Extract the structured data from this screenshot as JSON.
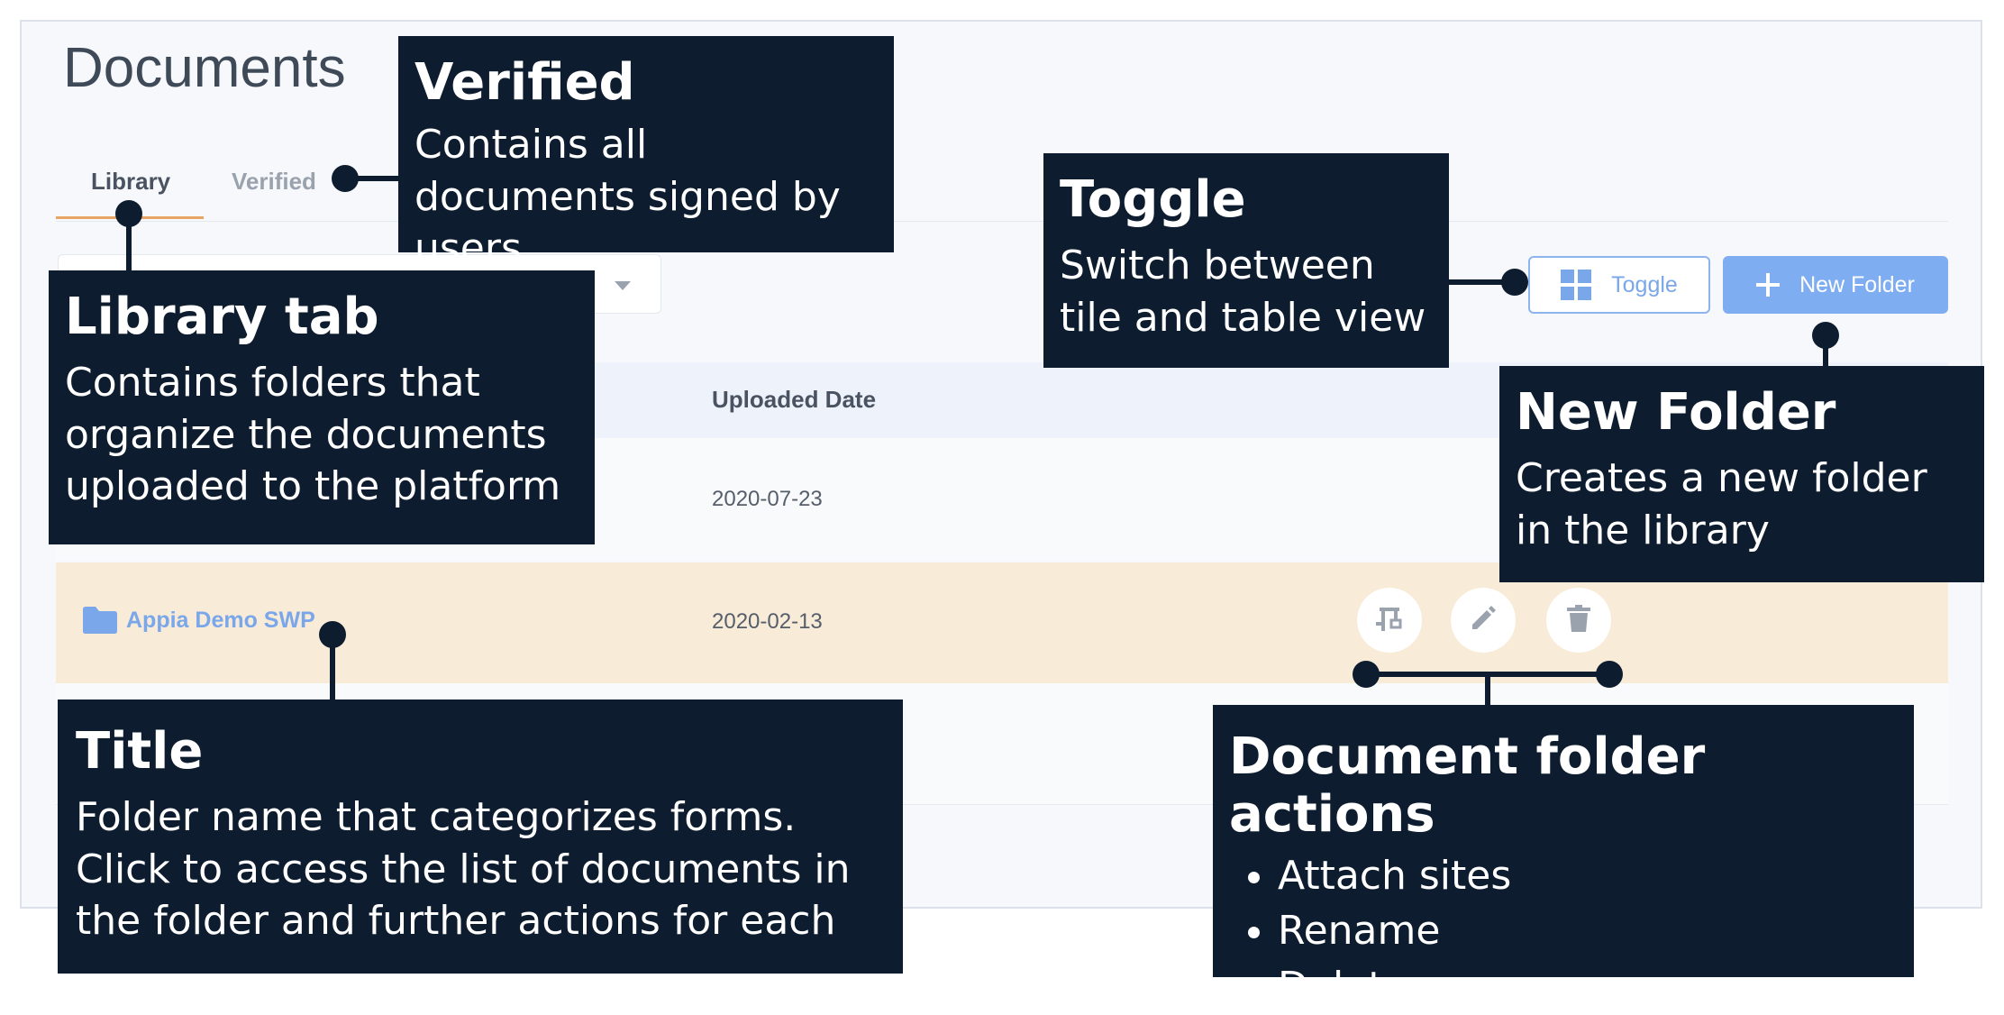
{
  "page": {
    "title": "Documents"
  },
  "tabs": [
    {
      "label": "Library",
      "active": true
    },
    {
      "label": "Verified",
      "active": false
    }
  ],
  "toolbar": {
    "toggle_label": "Toggle",
    "new_folder_label": "New Folder"
  },
  "table": {
    "columns": [
      "Uploaded Date"
    ],
    "rows": [
      {
        "name": "",
        "date": "2020-07-23"
      },
      {
        "name": "Appia Demo SWP",
        "date": "2020-02-13"
      }
    ]
  },
  "callouts": {
    "verified": {
      "title": "Verified",
      "desc": "Contains all documents signed by users"
    },
    "library": {
      "title": "Library tab",
      "desc": "Contains folders that organize the documents uploaded to the platform"
    },
    "toggle": {
      "title": "Toggle",
      "desc": "Switch between tile and table view"
    },
    "new_folder": {
      "title": "New Folder",
      "desc": "Creates a new folder in the library"
    },
    "title": {
      "title": "Title",
      "desc": "Folder name that categorizes forms. Click to access the list of documents in the folder and further actions for each"
    },
    "actions": {
      "title": "Document folder actions",
      "items": [
        "Attach sites",
        "Rename",
        "Delete"
      ]
    }
  },
  "colors": {
    "accent": "#7fadf1",
    "callout_bg": "#0d1c2e",
    "highlight_row": "#f8ebd7",
    "tab_underline": "#e8a462"
  },
  "icons": {
    "toggle": "grid-icon",
    "new_folder": "plus-icon",
    "folder": "folder-icon",
    "actions": [
      "attach-sites-icon",
      "pencil-icon",
      "trash-icon"
    ]
  }
}
